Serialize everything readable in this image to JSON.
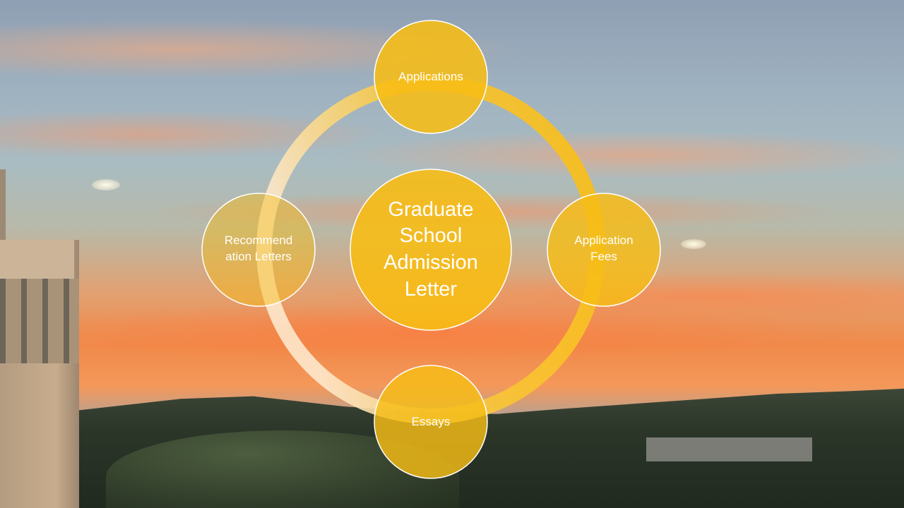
{
  "diagram": {
    "center": {
      "label_lines": [
        "Graduate",
        "School",
        "Admission",
        "Letter"
      ]
    },
    "nodes": [
      {
        "id": "applications",
        "label_lines": [
          "Applications"
        ]
      },
      {
        "id": "application-fees",
        "label_lines": [
          "Application",
          "Fees"
        ]
      },
      {
        "id": "essays",
        "label_lines": [
          "Essays"
        ]
      },
      {
        "id": "recommendation-letters",
        "label_lines": [
          "Recommend",
          "ation Letters"
        ]
      }
    ]
  },
  "colors": {
    "node_fill": "#f7bd16",
    "node_stroke": "#ffffff",
    "ring_start": "#f7bd16",
    "ring_end": "#fbe6c6"
  }
}
